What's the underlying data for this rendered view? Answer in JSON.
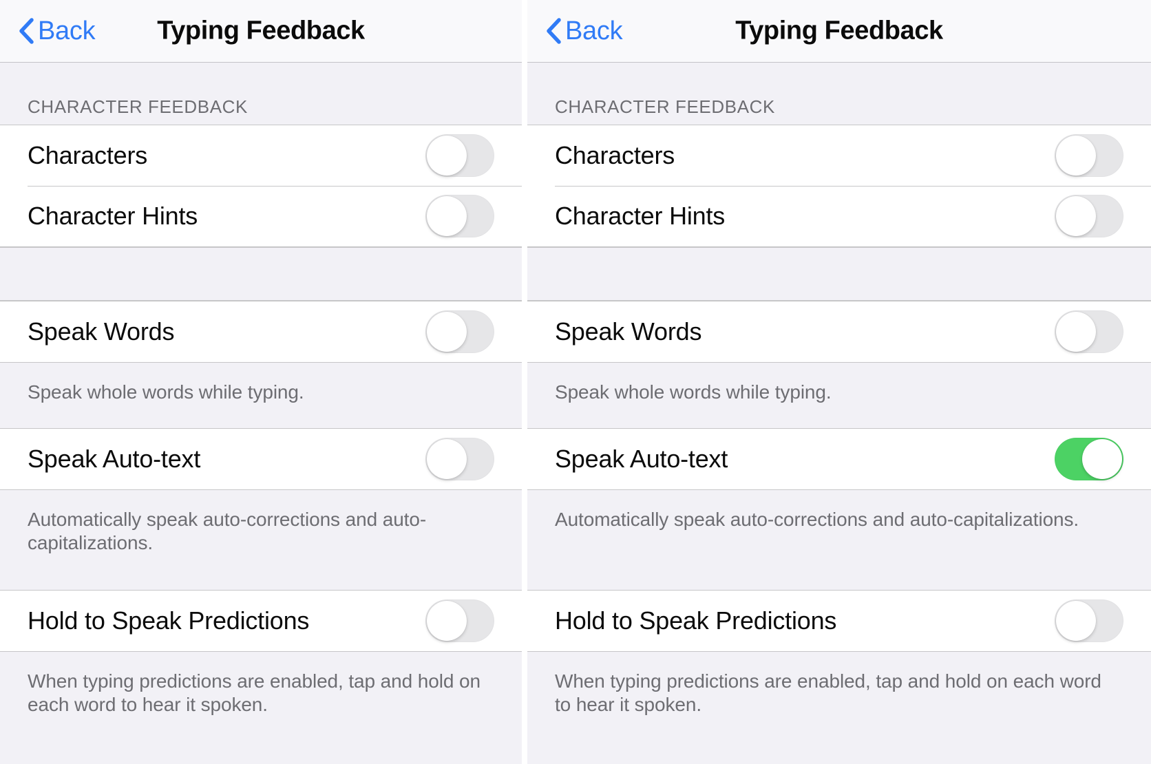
{
  "panels": [
    {
      "nav": {
        "back_label": "Back",
        "title": "Typing Feedback",
        "back_icon": "chevron-left-icon"
      },
      "section_header": "CHARACTER FEEDBACK",
      "rows": [
        {
          "label": "Characters",
          "state": "off"
        },
        {
          "label": "Character Hints",
          "state": "off"
        },
        {
          "label": "Speak Words",
          "state": "off"
        },
        {
          "label": "Speak Auto-text",
          "state": "off"
        },
        {
          "label": "Hold to Speak Predictions",
          "state": "off"
        }
      ],
      "notes": {
        "speak_words": "Speak whole words while typing.",
        "speak_auto_text": "Automatically speak auto-corrections and auto-capitalizations.",
        "hold_to_speak": "When typing predictions are enabled, tap and hold on each word to hear it spoken."
      }
    },
    {
      "nav": {
        "back_label": "Back",
        "title": "Typing Feedback",
        "back_icon": "chevron-left-icon"
      },
      "section_header": "CHARACTER FEEDBACK",
      "rows": [
        {
          "label": "Characters",
          "state": "off"
        },
        {
          "label": "Character Hints",
          "state": "off"
        },
        {
          "label": "Speak Words",
          "state": "off"
        },
        {
          "label": "Speak Auto-text",
          "state": "on"
        },
        {
          "label": "Hold to Speak Predictions",
          "state": "off"
        }
      ],
      "notes": {
        "speak_words": "Speak whole words while typing.",
        "speak_auto_text": "Automatically speak auto-corrections and auto-capitalizations.",
        "hold_to_speak": "When typing predictions are enabled, tap and hold on each word to hear it spoken."
      }
    }
  ],
  "colors": {
    "accent_blue": "#307bf6",
    "toggle_on_green": "#4cd264",
    "toggle_off_gray": "#e6e6e8",
    "grouped_background": "#f2f1f6",
    "row_background": "#ffffff",
    "separator": "#c6c6c8",
    "secondary_text": "#6d6d72",
    "primary_text": "#0b0b0b"
  }
}
